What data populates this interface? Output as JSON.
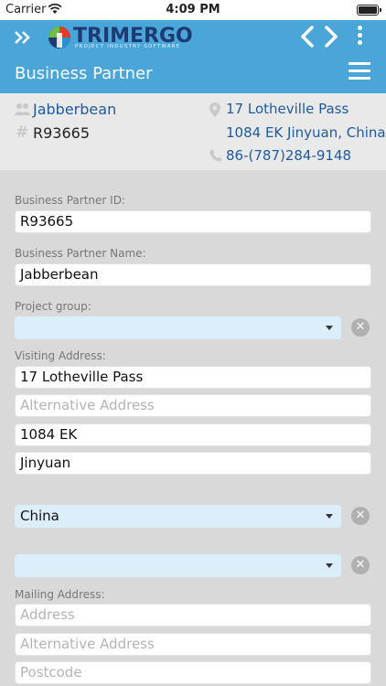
{
  "status_bar": {
    "carrier": "Carrier",
    "time": "4:09 PM"
  },
  "app_bar": {
    "brand": "TRIMERGO",
    "tagline": "PROJECT INDUSTRY SOFTWARE",
    "page_title": "Business Partner"
  },
  "summary": {
    "name": "Jabberbean",
    "id": "R93665",
    "street": "17 Lotheville Pass",
    "city": "1084 EK Jinyuan, China",
    "phone": "86-(787)284-9148"
  },
  "form": {
    "bp_id_label": "Business Partner ID:",
    "bp_id_value": "R93665",
    "bp_name_label": "Business Partner Name:",
    "bp_name_value": "Jabberbean",
    "project_group_label": "Project group:",
    "project_group_value": "",
    "visiting_label": "Visiting Address:",
    "visiting_street": "17 Lotheville Pass",
    "visiting_alt_placeholder": "Alternative Address",
    "visiting_postcode": "1084 EK",
    "visiting_city": "Jinyuan",
    "visiting_country": "China",
    "visiting_region": "",
    "mailing_label": "Mailing Address:",
    "mailing_address_placeholder": "Address",
    "mailing_alt_placeholder": "Alternative Address",
    "mailing_postcode_placeholder": "Postcode"
  },
  "icons": {
    "menu_expand": "double-chevron-right-icon",
    "logo": "trimergo-logo",
    "nav_prev": "chevron-left-icon",
    "nav_next": "chevron-right-icon",
    "more": "kebab-menu-icon",
    "menu": "hamburger-icon",
    "partner": "users-icon",
    "id": "hash-icon",
    "location": "map-pin-icon",
    "phone": "phone-icon",
    "clear": "clear-icon",
    "dropdown": "caret-down-icon"
  },
  "colors": {
    "app_bar": "#4aa6d8",
    "link": "#1e5aa0",
    "select_bg": "#dceefa",
    "brand": "#1d3a73"
  }
}
